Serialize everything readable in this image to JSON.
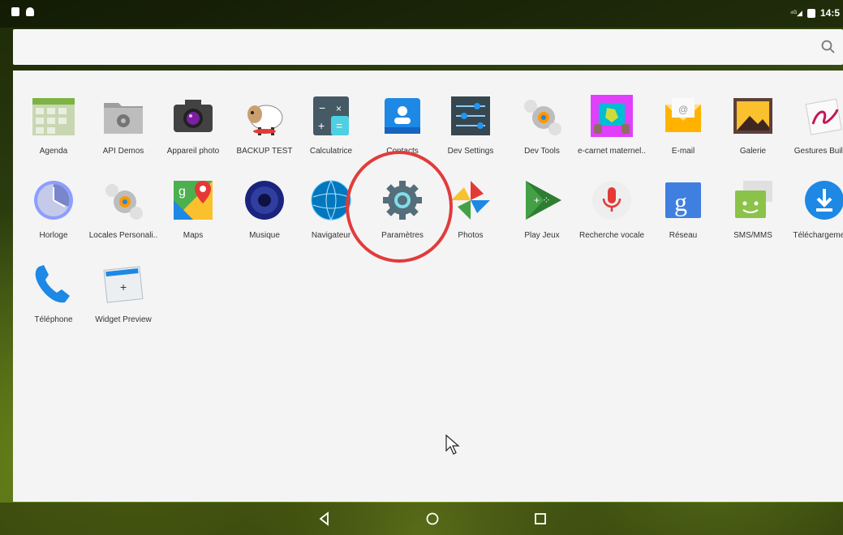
{
  "status_bar": {
    "signal_label": "",
    "time": "14:5"
  },
  "search": {
    "placeholder": ""
  },
  "apps": [
    {
      "label": "Agenda",
      "icon": "calendar-grid-icon"
    },
    {
      "label": "API Demos",
      "icon": "folder-gear-icon"
    },
    {
      "label": "Appareil photo",
      "icon": "camera-icon"
    },
    {
      "label": "BACKUP TEST",
      "icon": "sheep-icon"
    },
    {
      "label": "Calculatrice",
      "icon": "calculator-icon"
    },
    {
      "label": "Contacts",
      "icon": "contacts-icon"
    },
    {
      "label": "Dev Settings",
      "icon": "sliders-icon"
    },
    {
      "label": "Dev Tools",
      "icon": "gears-icon"
    },
    {
      "label": "e-carnet maternel..",
      "icon": "hand-tablet-icon"
    },
    {
      "label": "E-mail",
      "icon": "envelope-icon"
    },
    {
      "label": "Galerie",
      "icon": "gallery-icon"
    },
    {
      "label": "Gestures Builder",
      "icon": "gesture-icon"
    },
    {
      "label": "Horloge",
      "icon": "clock-icon"
    },
    {
      "label": "Locales Personali..",
      "icon": "gears-icon"
    },
    {
      "label": "Maps",
      "icon": "maps-icon"
    },
    {
      "label": "Musique",
      "icon": "speaker-icon"
    },
    {
      "label": "Navigateur",
      "icon": "globe-icon"
    },
    {
      "label": "Paramètres",
      "icon": "settings-gear-icon"
    },
    {
      "label": "Photos",
      "icon": "pinwheel-icon"
    },
    {
      "label": "Play Jeux",
      "icon": "gamepad-icon"
    },
    {
      "label": "Recherche vocale",
      "icon": "microphone-icon"
    },
    {
      "label": "Réseau",
      "icon": "google-g-icon"
    },
    {
      "label": "SMS/MMS",
      "icon": "message-icon"
    },
    {
      "label": "Téléchargements",
      "icon": "download-icon"
    },
    {
      "label": "Téléphone",
      "icon": "phone-icon"
    },
    {
      "label": "Widget Preview",
      "icon": "widget-icon"
    }
  ],
  "highlighted_app": "Paramètres",
  "nav": {
    "back": "◁",
    "home": "○",
    "recents": "□"
  },
  "colors": {
    "highlight": "#e23b3b",
    "drawer_bg": "#f4f4f4"
  }
}
